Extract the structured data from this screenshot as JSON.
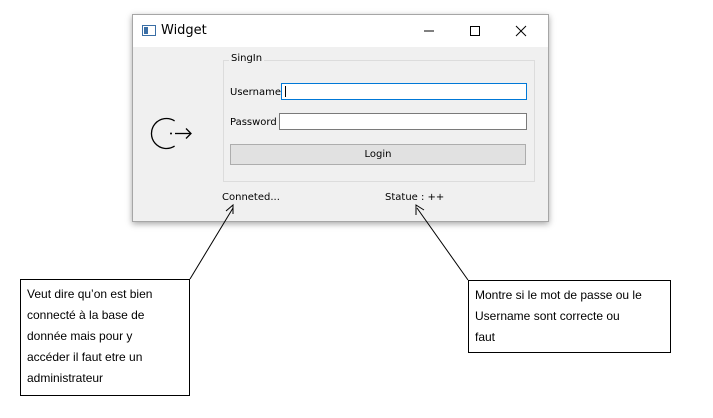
{
  "window": {
    "title": "Widget",
    "icons": {
      "app": "app-window-icon",
      "minimize": "minimize-icon",
      "maximize": "maximize-icon",
      "close": "close-icon",
      "login": "login-arrow-icon"
    }
  },
  "form": {
    "group_title": "SingIn",
    "username_label": "Username",
    "username_value": "",
    "password_label": "Password",
    "password_value": "",
    "login_button": "Login"
  },
  "status": {
    "connection": "Conneted...",
    "statue": "Statue : ++"
  },
  "annotations": {
    "left": {
      "lines": [
        "Veut dire qu’on est bien",
        "connecté à la base de",
        "donnée mais pour y",
        "accéder il faut etre un",
        "administrateur"
      ]
    },
    "right": {
      "lines": [
        "Montre si le mot de passe ou le",
        "Username sont correcte ou",
        "faut"
      ]
    }
  },
  "colors": {
    "window_bg": "#f0f0f0",
    "focus_border": "#0078d7",
    "button_bg": "#e1e1e1"
  }
}
